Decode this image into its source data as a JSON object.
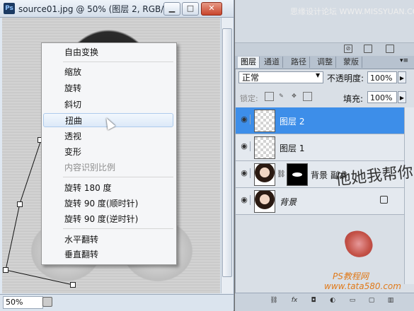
{
  "document": {
    "title": "source01.jpg @ 50% (图层 2, RGB/...",
    "app_icon": "Ps",
    "zoom": "50%",
    "buttons": {
      "minimize": "▁",
      "restore": "□",
      "close": "✕"
    }
  },
  "context_menu": {
    "items": [
      {
        "label": "自由变换",
        "disabled": false,
        "highlight": false
      },
      {
        "label": "缩放",
        "disabled": false,
        "highlight": false
      },
      {
        "label": "旋转",
        "disabled": false,
        "highlight": false
      },
      {
        "label": "斜切",
        "disabled": false,
        "highlight": false
      },
      {
        "label": "扭曲",
        "disabled": false,
        "highlight": true
      },
      {
        "label": "透视",
        "disabled": false,
        "highlight": false
      },
      {
        "label": "变形",
        "disabled": false,
        "highlight": false
      },
      {
        "label": "内容识别比例",
        "disabled": true,
        "highlight": false
      },
      {
        "label": "旋转 180 度",
        "disabled": false,
        "highlight": false
      },
      {
        "label": "旋转 90 度(顺时针)",
        "disabled": false,
        "highlight": false
      },
      {
        "label": "旋转 90 度(逆时针)",
        "disabled": false,
        "highlight": false
      },
      {
        "label": "水平翻转",
        "disabled": false,
        "highlight": false
      },
      {
        "label": "垂直翻转",
        "disabled": false,
        "highlight": false
      }
    ]
  },
  "brand": "思缘设计论坛 WWW.MISSYUAN.COM",
  "layers_panel": {
    "tabs": [
      "图层",
      "通道",
      "路径",
      "调整",
      "蒙版"
    ],
    "blend_mode": "正常",
    "opacity_label": "不透明度:",
    "opacity_value": "100%",
    "lock_label": "锁定:",
    "fill_label": "填充:",
    "fill_value": "100%",
    "layers": [
      {
        "name": "图层 2",
        "selected": true
      },
      {
        "name": "图层 1",
        "selected": false
      },
      {
        "name": "背景 副本",
        "selected": false
      },
      {
        "name": "背景",
        "selected": false
      }
    ]
  },
  "signature": "他她我帮你",
  "watermark": {
    "line1": "PS教程网",
    "line2": "www.tata580.com"
  },
  "colors": {
    "selection": "#3d8ee9",
    "highlight_border": "#aecbec",
    "watermark": "#e07a1a"
  }
}
